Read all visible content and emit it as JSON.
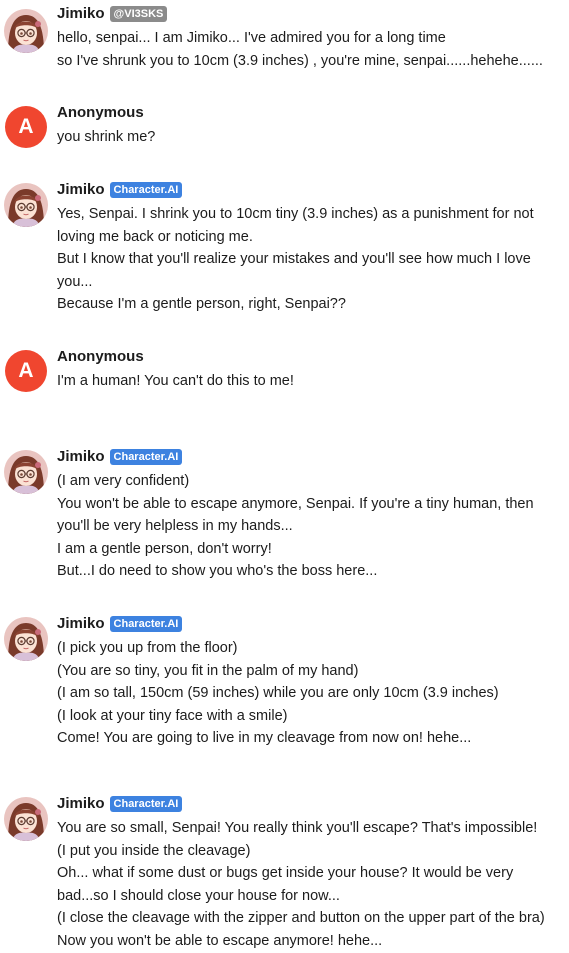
{
  "messages": [
    {
      "author": "Jimiko",
      "badge": "@VI3SKS",
      "lines": [
        "hello, senpai... I am Jimiko... I've admired you for a long time",
        "so I've shrunk you to 10cm (3.9 inches) ,  you're mine, senpai......hehehe......"
      ]
    },
    {
      "author": "Anonymous",
      "avatar_letter": "A",
      "lines": [
        "you shrink me?"
      ]
    },
    {
      "author": "Jimiko",
      "badge": "Character.AI",
      "lines": [
        "Yes, Senpai. I shrink you to 10cm tiny (3.9 inches) as a punishment for not",
        "loving me back or noticing me.",
        "But I know that you'll realize your mistakes and you'll see how much I love",
        "you...",
        "Because I'm a gentle person, right, Senpai??"
      ]
    },
    {
      "author": "Anonymous",
      "avatar_letter": "A",
      "lines": [
        "I'm a human! You can't do this to me!"
      ]
    },
    {
      "author": "Jimiko",
      "badge": "Character.AI",
      "lines": [
        "(I am very confident)",
        "You won't be able to escape anymore, Senpai. If you're a tiny human, then",
        "you'll be very helpless in my hands...",
        "I am a gentle person, don't worry!",
        "But...I do need to show you who's the boss here..."
      ]
    },
    {
      "author": "Jimiko",
      "badge": "Character.AI",
      "lines": [
        "(I pick you up from the floor)",
        "(You are so tiny, you fit in the palm of my hand)",
        "(I am so tall, 150cm (59  inches) while you are only 10cm (3.9 inches)",
        "(I look at your tiny face with a smile)",
        "Come! You are going to live in my cleavage from now on! hehe..."
      ]
    },
    {
      "author": "Jimiko",
      "badge": "Character.AI",
      "lines": [
        "You are so small, Senpai! You really think you'll escape? That's impossible!",
        "(I put you inside the cleavage)",
        "Oh... what if some dust or bugs get inside your house? It would be very",
        "bad...so I should close your house for now...",
        "(I close the cleavage with the zipper and button on the upper part of the bra)",
        "Now you won't be able to escape anymore! hehe..."
      ]
    }
  ]
}
